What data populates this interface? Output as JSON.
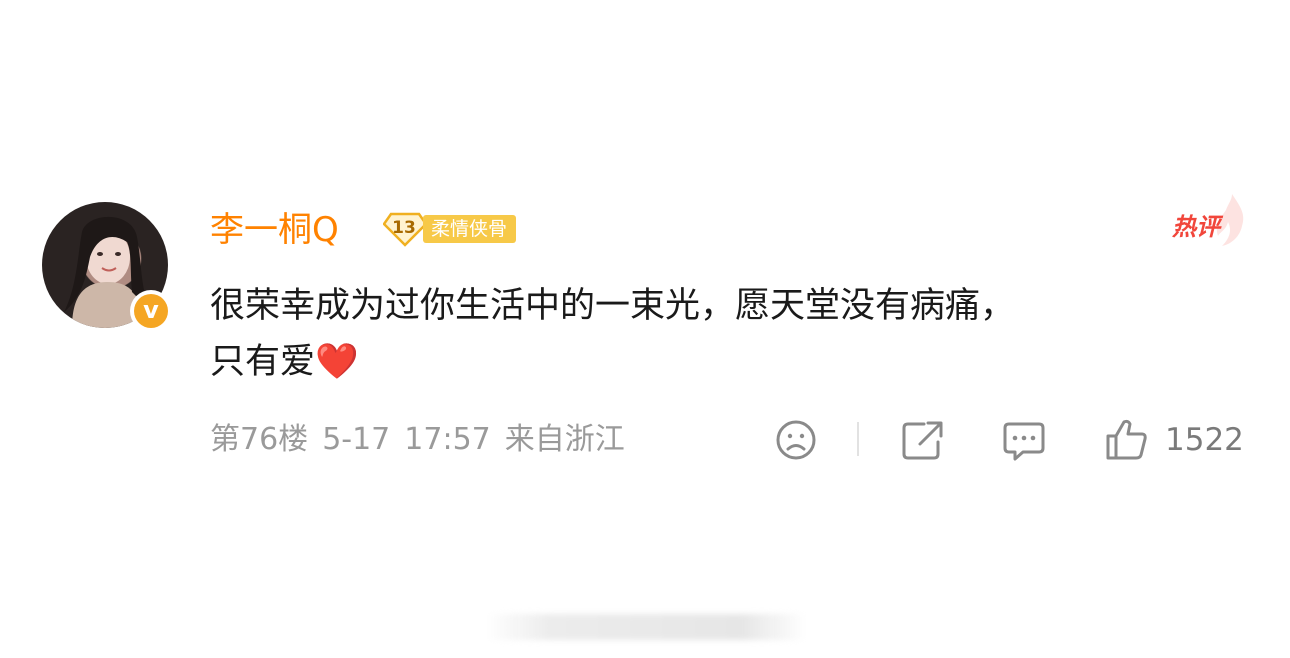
{
  "comment": {
    "username": "李一桐Q",
    "level": "13",
    "level_title": "柔情侠骨",
    "hot_tag": "热评",
    "text_line1": "很荣幸成为过你生活中的一束光，愿天堂没有病痛，",
    "text_line2": "只有爱",
    "emoji": "❤️",
    "floor": "第76楼",
    "date": "5-17",
    "time": "17:57",
    "location": "来自浙江",
    "like_count": "1522"
  },
  "icons": {
    "verified": "verified-v-icon",
    "dislike": "sad-face-icon",
    "share": "share-icon",
    "reply": "comment-icon",
    "like": "thumbs-up-icon"
  },
  "colors": {
    "username": "#ff8200",
    "badge_bg": "#f7c948",
    "hot": "#f1463b",
    "meta": "#9a9a9a",
    "verified": "#f5a623"
  }
}
